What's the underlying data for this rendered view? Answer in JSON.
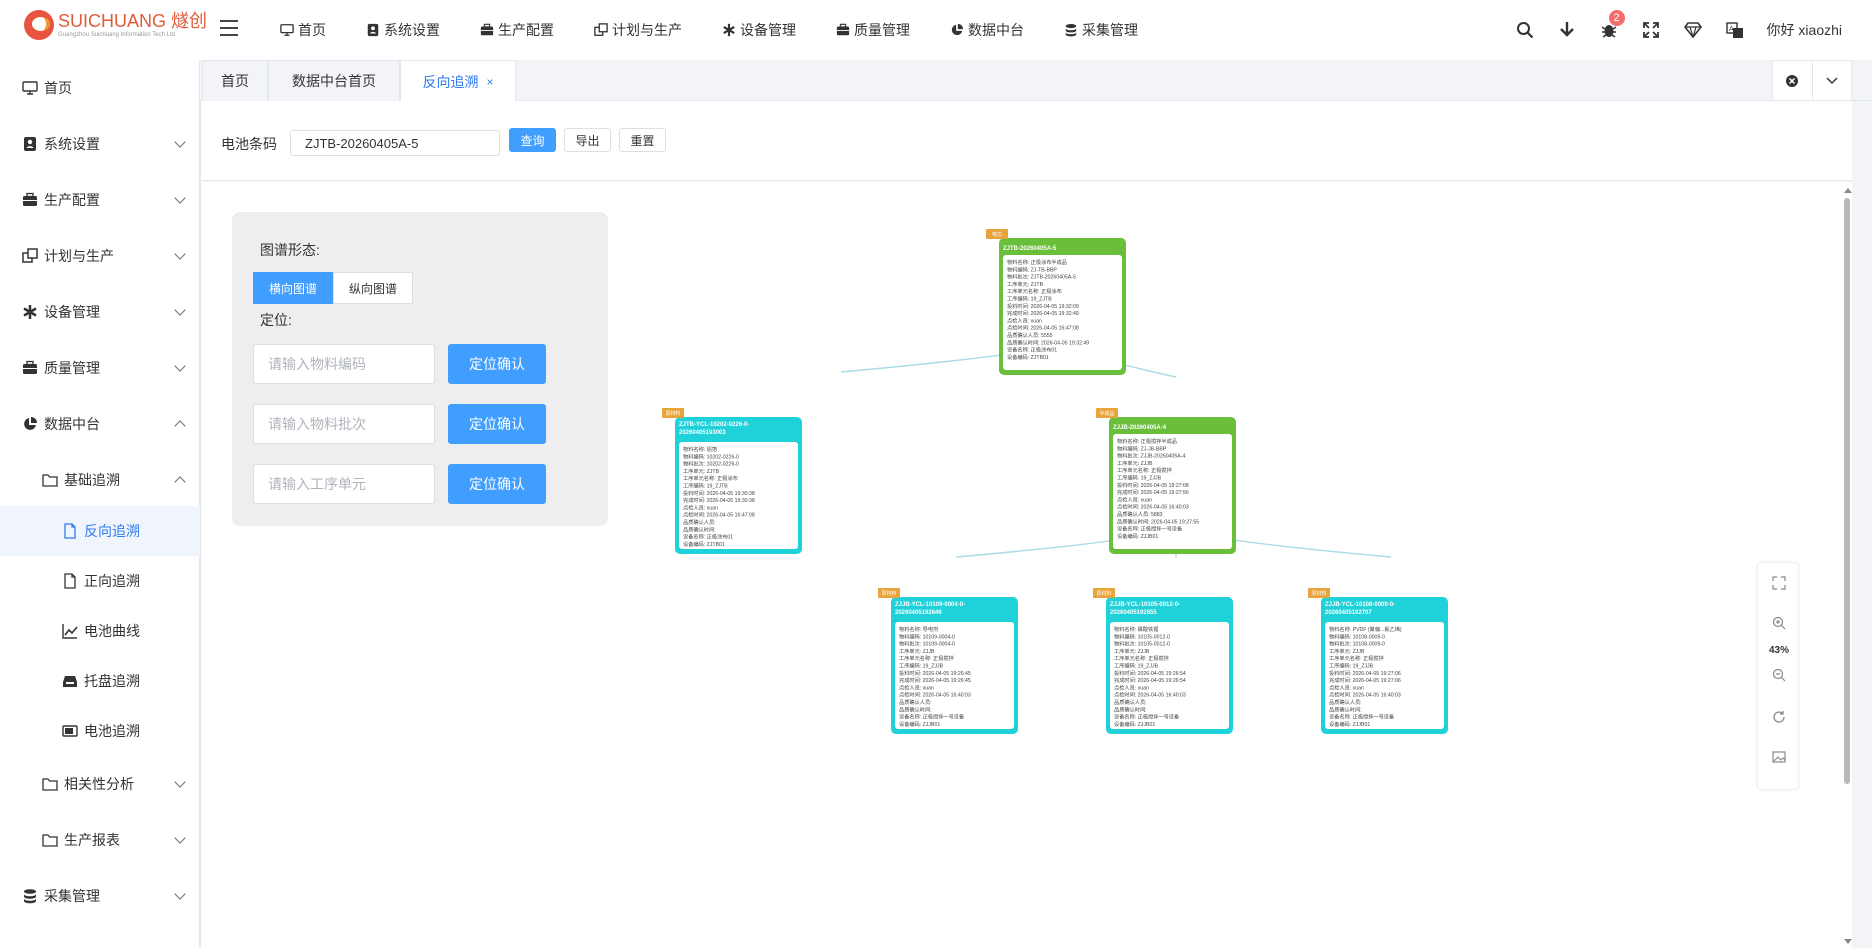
{
  "brand": {
    "name": "SUICHUANG 燧创",
    "sub": "Guangzhou Suichuang Information Tech Ltd"
  },
  "topnav": [
    {
      "label": "首页",
      "icon": "monitor-icon"
    },
    {
      "label": "系统设置",
      "icon": "user-card-icon"
    },
    {
      "label": "生产配置",
      "icon": "briefcase-icon"
    },
    {
      "label": "计划与生产",
      "icon": "windows-icon"
    },
    {
      "label": "设备管理",
      "icon": "asterisk-icon"
    },
    {
      "label": "质量管理",
      "icon": "briefcase-icon"
    },
    {
      "label": "数据中台",
      "icon": "pie-chart-icon"
    },
    {
      "label": "采集管理",
      "icon": "database-icon"
    }
  ],
  "header": {
    "badge_count": "2",
    "greeting": "你好 xiaozhi"
  },
  "sidebar": {
    "items": [
      {
        "label": "首页"
      },
      {
        "label": "系统设置"
      },
      {
        "label": "生产配置"
      },
      {
        "label": "计划与生产"
      },
      {
        "label": "设备管理"
      },
      {
        "label": "质量管理"
      },
      {
        "label": "数据中台"
      },
      {
        "label": "基础追溯"
      },
      {
        "label": "反向追溯"
      },
      {
        "label": "正向追溯"
      },
      {
        "label": "电池曲线"
      },
      {
        "label": "托盘追溯"
      },
      {
        "label": "电池追溯"
      },
      {
        "label": "相关性分析"
      },
      {
        "label": "生产报表"
      },
      {
        "label": "采集管理"
      }
    ]
  },
  "tabs": [
    {
      "label": "首页"
    },
    {
      "label": "数据中台首页"
    },
    {
      "label": "反向追溯",
      "close": "×"
    }
  ],
  "search": {
    "label": "电池条码",
    "value": "ZJTB-20260405A-5",
    "query": "查询",
    "export": "导出",
    "reset": "重置"
  },
  "panel": {
    "shape_label": "图谱形态:",
    "horizontal": "横向图谱",
    "vertical": "纵向图谱",
    "locate_label": "定位:",
    "ph_material_code": "请输入物料编码",
    "ph_material_batch": "请输入物料批次",
    "ph_process_unit": "请输入工序单元",
    "confirm": "定位确认"
  },
  "zoom": {
    "level": "43%"
  },
  "tree_nodes": [
    {
      "tag": "电芯",
      "title": "ZJTB-20260405A-5",
      "color": "green",
      "lines": [
        "物料名称: 正极涂布半成品",
        "物料编码: ZJ-TB-BBP",
        "物料批次: ZJTB-20260405A-5",
        "工序单元: ZJTB",
        "工序单元名称: 正极涂布",
        "工序编码: 19_ZJTB",
        "投料时间: 2026-04-05 19:32:09",
        "完成时间: 2026-04-05 19:32:49",
        "点检人员: xuan",
        "点检时间: 2026-04-05 16:47:08",
        "品质确认人员: 5555",
        "品质确认时间: 2026-04-05 19:32:49",
        "设备名称: 正极涂布01",
        "设备编码: ZJTB01"
      ]
    },
    {
      "tag": "原材料",
      "title": "ZJTB-YCL-10202-0226-0-20260405193003",
      "color": "cyan",
      "lines": [
        "物料名称: 铝箔",
        "物料编码: 10202-0226-0",
        "物料批次: 10202-0226-0",
        "工序单元: ZJTB",
        "工序单元名称: 正极涂布",
        "工序编码: 19_ZJTB",
        "投料时间: 2026-04-05 19:30:38",
        "完成时间: 2026-04-05 19:30:38",
        "点检人员: xuan",
        "点检时间: 2026-04-05 16:47:08",
        "品质确认人员:",
        "品质确认时间:",
        "设备名称: 正极涂布01",
        "设备编码: ZJTB01"
      ]
    },
    {
      "tag": "半成品",
      "title": "ZJJB-20260405A-4",
      "color": "green",
      "lines": [
        "物料名称: 正极搅拌半成品",
        "物料编码: ZJ-JB-BBP",
        "物料批次: ZJJB-20260405A-4",
        "工序单元: ZJJB",
        "工序单元名称: 正极搅拌",
        "工序编码: 19_ZJJB",
        "投料时间: 2026-04-05 19:27:08",
        "完成时间: 2026-04-05 19:27:56",
        "点检人员: xuan",
        "点检时间: 2026-04-05 16:40:03",
        "品质确认人员: 5883",
        "品质确认时间: 2026-04-05 19:27:55",
        "设备名称: 正极搅拌一号设备",
        "设备编码: ZJJB01"
      ]
    },
    {
      "tag": "原材料",
      "title": "ZJJB-YCL-10109-0004-0-20260405192646",
      "color": "cyan",
      "lines": [
        "物料名称: 导电剂",
        "物料编码: 10109-0004-0",
        "物料批次: 10109-0004-0",
        "工序单元: ZJJB",
        "工序单元名称: 正极搅拌",
        "工序编码: 19_ZJJB",
        "投料时间: 2026-04-05 19:26:45",
        "完成时间: 2026-04-05 19:26:45",
        "点检人员: xuan",
        "点检时间: 2026-04-05 16:40:03",
        "品质确认人员:",
        "品质确认时间:",
        "设备名称: 正极搅拌一号设备",
        "设备编码: ZJJB01"
      ]
    },
    {
      "tag": "原材料",
      "title": "ZJJB-YCL-10105-0012-0-20260405192655",
      "color": "cyan",
      "lines": [
        "物料名称: 磷酸铁锂",
        "物料编码: 10105-0012-0",
        "物料批次: 10105-0012-0",
        "工序单元: ZJJB",
        "工序单元名称: 正极搅拌",
        "工序编码: 19_ZJJB",
        "投料时间: 2026-04-05 19:26:54",
        "完成时间: 2026-04-05 19:26:54",
        "点检人员: xuan",
        "点检时间: 2026-04-05 16:40:03",
        "品质确认人员:",
        "品质确认时间:",
        "设备名称: 正极搅拌一号设备",
        "设备编码: ZJJB01"
      ]
    },
    {
      "tag": "原材料",
      "title": "ZJJB-YCL-10108-0009-0-20260405192707",
      "color": "cyan",
      "lines": [
        "物料名称: PVDF (聚偏...氟乙烯)",
        "物料编码: 10108-0009-0",
        "物料批次: 10108-0009-0",
        "工序单元: ZJJB",
        "工序单元名称: 正极搅拌",
        "工序编码: 19_ZJJB",
        "投料时间: 2026-04-05 19:27:06",
        "完成时间: 2026-04-05 19:27:06",
        "点检人员: xuan",
        "点检时间: 2026-04-05 16:40:03",
        "品质确认人员:",
        "品质确认时间:",
        "设备名称: 正极搅拌一号设备",
        "设备编码: ZJJB01"
      ]
    }
  ],
  "colors": {
    "primary": "#409eff",
    "green": "#6abf3a",
    "cyan": "#1fd1d8",
    "tag": "#e8a33a",
    "link": "#a9dbe9"
  }
}
